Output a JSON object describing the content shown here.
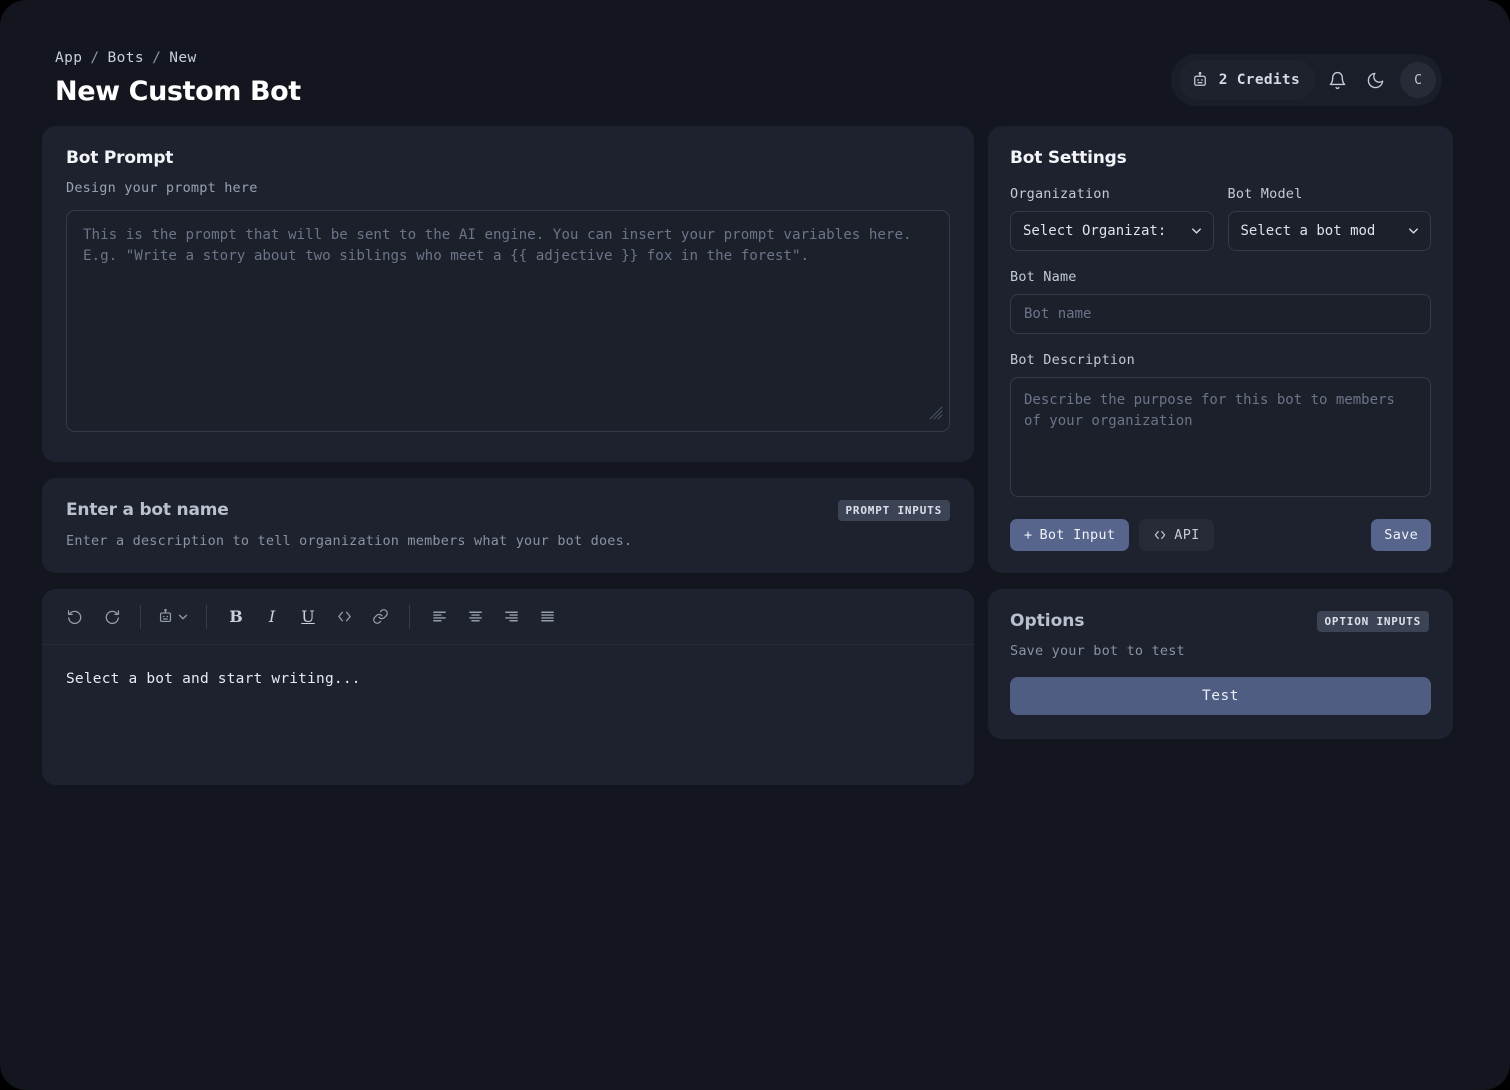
{
  "header": {
    "breadcrumb": [
      "App",
      "Bots",
      "New"
    ],
    "breadcrumb_separator": "/",
    "title": "New Custom Bot",
    "credits_label": "2 Credits",
    "credits_icon": "robot-icon",
    "notification_icon": "bell-icon",
    "theme_icon": "moon-icon",
    "avatar_initial": "C"
  },
  "bot_prompt": {
    "title": "Bot Prompt",
    "subtitle": "Design your prompt here",
    "textarea_placeholder": "This is the prompt that will be sent to the AI engine. You can insert your prompt variables here. E.g. \"Write a story about two siblings who meet a {{ adjective }} fox in the forest\".",
    "textarea_value": ""
  },
  "bot_name_card": {
    "title": "Enter a bot name",
    "subtitle": "Enter a description to tell organization members what your bot does.",
    "badge": "PROMPT INPUTS"
  },
  "editor": {
    "toolbar": [
      {
        "name": "undo-icon",
        "label": ""
      },
      {
        "name": "redo-icon",
        "label": ""
      },
      {
        "name": "robot-select-icon",
        "label": ""
      },
      {
        "name": "bold-icon",
        "label": "B"
      },
      {
        "name": "italic-icon",
        "label": "I"
      },
      {
        "name": "underline-icon",
        "label": "U"
      },
      {
        "name": "code-icon",
        "label": "<>"
      },
      {
        "name": "link-icon",
        "label": ""
      },
      {
        "name": "align-left-icon",
        "label": ""
      },
      {
        "name": "align-center-icon",
        "label": ""
      },
      {
        "name": "align-right-icon",
        "label": ""
      },
      {
        "name": "align-justify-icon",
        "label": ""
      }
    ],
    "body_text": "Select a bot and start writing..."
  },
  "bot_settings": {
    "title": "Bot Settings",
    "organization_label": "Organization",
    "organization_value": "Select Organizat:",
    "bot_model_label": "Bot Model",
    "bot_model_value": "Select a bot mod",
    "bot_name_label": "Bot Name",
    "bot_name_placeholder": "Bot name",
    "bot_name_value": "",
    "bot_description_label": "Bot Description",
    "bot_description_placeholder": "Describe the purpose for this bot to members of your organization",
    "bot_description_value": "",
    "bot_input_button": "Bot Input",
    "bot_input_prefix": "+",
    "api_button": "API",
    "save_button": "Save"
  },
  "options": {
    "title": "Options",
    "badge": "OPTION INPUTS",
    "subtitle": "Save your bot to test",
    "test_button": "Test"
  },
  "colors": {
    "page_bg": "#14161f",
    "card_bg": "#1d222e",
    "input_bg": "#1b202b",
    "border": "#333a4a",
    "accent": "#57648b",
    "accent_test": "#4f5d83",
    "badge_bg": "#3b4354",
    "text_primary": "#f2f4f8",
    "text_muted": "#9aa2b2",
    "placeholder": "#6d7488"
  }
}
